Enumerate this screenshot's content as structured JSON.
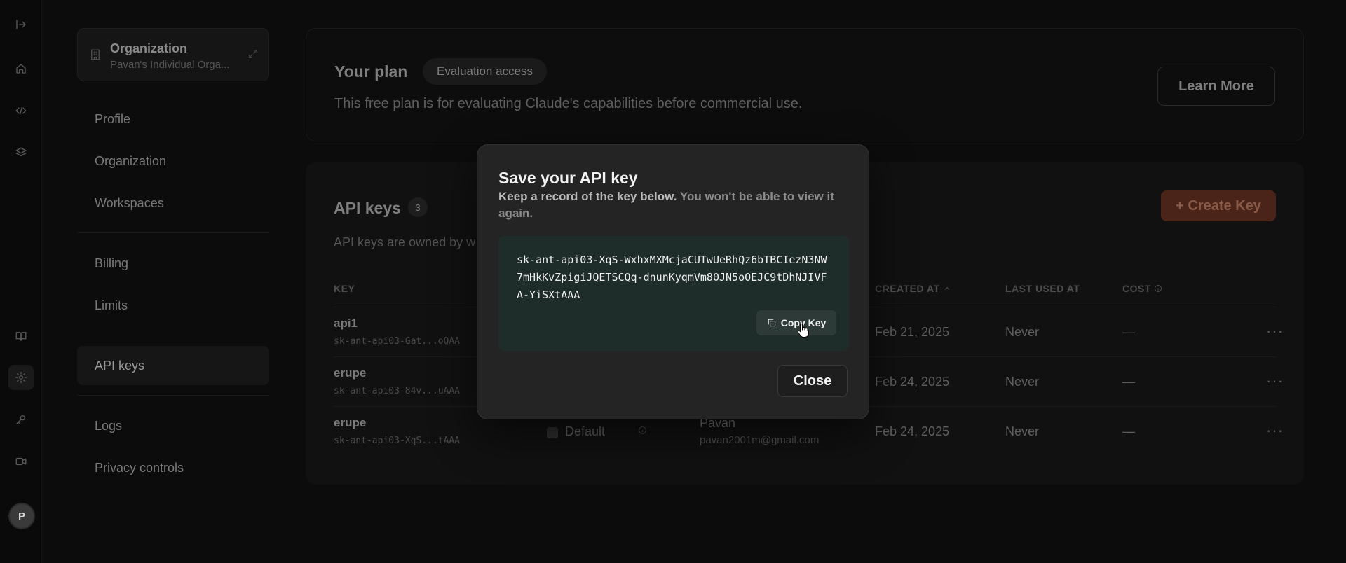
{
  "sidebar": {
    "org_title": "Organization",
    "org_sub": "Pavan's Individual Orga...",
    "items": [
      {
        "label": "Profile"
      },
      {
        "label": "Organization"
      },
      {
        "label": "Workspaces"
      },
      {
        "label": "Billing"
      },
      {
        "label": "Limits"
      },
      {
        "label": "API keys"
      },
      {
        "label": "Logs"
      },
      {
        "label": "Privacy controls"
      }
    ],
    "active_item": "API keys",
    "avatar_initial": "P"
  },
  "rail_icons": [
    "sidebar-toggle-icon",
    "home-icon",
    "code-icon",
    "layers-icon",
    "book-icon",
    "gear-icon",
    "key-icon",
    "video-icon"
  ],
  "plan": {
    "title": "Your plan",
    "badge": "Evaluation access",
    "description": "This free plan is for evaluating Claude's capabilities before commercial use.",
    "learn_more": "Learn More"
  },
  "api_keys": {
    "title": "API keys",
    "count": "3",
    "description": "API keys are owned by w",
    "create_label": "+ Create Key",
    "columns": {
      "key": "KEY",
      "created_at": "CREATED AT",
      "last_used_at": "LAST USED AT",
      "cost": "COST"
    },
    "rows": [
      {
        "name": "api1",
        "key": "sk-ant-api03-Gat...oQAA",
        "created": "Feb 21, 2025",
        "last_used": "Never",
        "cost": "—"
      },
      {
        "name": "erupe",
        "key": "sk-ant-api03-84v...uAAA",
        "created": "Feb 24, 2025",
        "last_used": "Never",
        "cost": "—"
      },
      {
        "name": "erupe",
        "key": "sk-ant-api03-XqS...tAAA",
        "workspace": "Default",
        "owner": "Pavan",
        "owner_email": "pavan2001m@gmail.com",
        "created": "Feb 24, 2025",
        "last_used": "Never",
        "cost": "—"
      }
    ],
    "row_menu": "···"
  },
  "modal": {
    "title": "Save your API key",
    "desc_main": "Keep a record of the key below.",
    "desc_muted": " You won't be able to view it again.",
    "key_value": "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",
    "copy_label": "Copy Key",
    "close_label": "Close"
  },
  "colors": {
    "background": "#0c0c0c",
    "modal": "#242424",
    "keybox": "#1f2d2a",
    "create_button": "#4a2418"
  }
}
